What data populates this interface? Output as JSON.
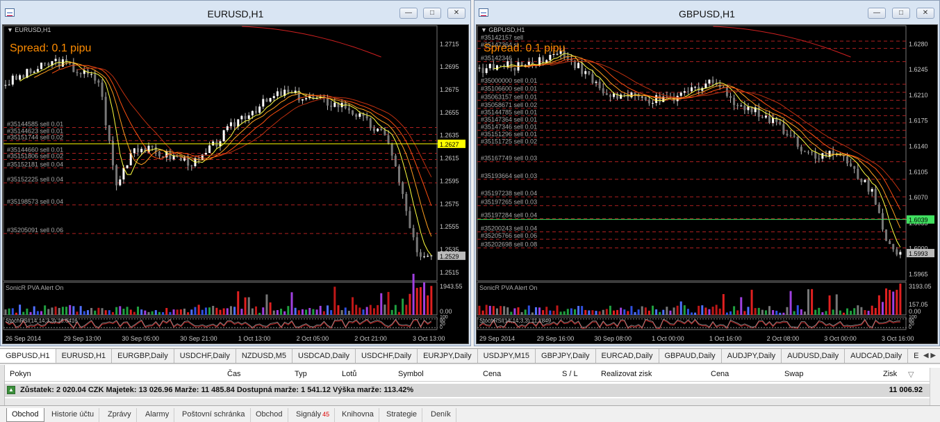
{
  "windows": [
    {
      "title": "EURUSD,H1",
      "symbol_label": "EURUSD,H1",
      "spread_text": "Spread: 0.1 pipu",
      "indicator_label": "SonicR PVA    Alert On",
      "osc_label": "StochRSI(14,14,3,3) 16.6416",
      "price_axis": [
        "1.2715",
        "1.2695",
        "1.2675",
        "1.2655",
        "1.2635",
        "1.2615",
        "1.2595",
        "1.2575",
        "1.2555",
        "1.2535",
        "1.2515"
      ],
      "price_range": [
        1.2507,
        1.2731
      ],
      "current_price": "1.2627",
      "bid_price": "1.2529",
      "volume_axis": [
        "1943.55",
        "0.00"
      ],
      "osc_axis": [
        "100",
        "80",
        "20",
        "0"
      ],
      "time_axis": [
        "26 Sep 2014",
        "29 Sep 13:00",
        "30 Sep 05:00",
        "30 Sep 21:00",
        "1 Oct 13:00",
        "2 Oct 05:00",
        "2 Oct 21:00",
        "3 Oct 13:00"
      ],
      "orders": [
        {
          "label": "#35144585 sell 0.01",
          "price": 1.26412
        },
        {
          "label": "#35144623 sell 0.01",
          "price": 1.26352
        },
        {
          "label": "#35151744 sell 0.02",
          "price": 1.26298
        },
        {
          "label": "#35144660 sell 0.01",
          "price": 1.26187
        },
        {
          "label": "#35151806 sell 0.02",
          "price": 1.26132
        },
        {
          "label": "#35152181 sell 0.04",
          "price": 1.2606
        },
        {
          "label": "#35152225 sell 0.04",
          "price": 1.25928
        },
        {
          "label": "#35198573 sell 0.04",
          "price": 1.25735
        },
        {
          "label": "#35205091 sell 0.06",
          "price": 1.25485
        }
      ],
      "colors": {
        "current_line": "#ffff00",
        "order_line": "#b02020",
        "bg": "#000000"
      }
    },
    {
      "title": "GBPUSD,H1",
      "symbol_label": "GBPUSD,H1",
      "spread_text": "Spread: 0.1 pipu",
      "indicator_label": "SonicR PVA    Alert On",
      "osc_label": "StochRSI(14,14,3,3) 11.1849",
      "price_axis": [
        "1.6280",
        "1.6245",
        "1.6210",
        "1.6175",
        "1.6140",
        "1.6105",
        "1.6070",
        "1.6035",
        "1.6000",
        "1.5965"
      ],
      "price_range": [
        1.5955,
        1.6305
      ],
      "current_price": "1.6039",
      "bid_price": "1.5993",
      "volume_axis": [
        "3193.05",
        "157.05",
        "0.00"
      ],
      "osc_axis": [
        "100",
        "80",
        "20",
        "0"
      ],
      "time_axis": [
        "29 Sep 2014",
        "29 Sep 16:00",
        "30 Sep 08:00",
        "1 Oct 00:00",
        "1 Oct 16:00",
        "2 Oct 08:00",
        "3 Oct 00:00",
        "3 Oct 16:00"
      ],
      "orders": [
        {
          "label": "#35142157 sell",
          "price": 1.6283
        },
        {
          "label": "#35147364 sl",
          "price": 1.6273
        },
        {
          "label": "#35142346",
          "price": 1.6255
        },
        {
          "label": "#35000000 sell 0.01",
          "price": 1.6224
        },
        {
          "label": "#35106600 sell 0.01",
          "price": 1.6213
        },
        {
          "label": "#35063157 sell 0.01",
          "price": 1.6202
        },
        {
          "label": "#35058671 sell 0.02",
          "price": 1.6191
        },
        {
          "label": "#35144785 sell 0.01",
          "price": 1.6181
        },
        {
          "label": "#35147364 sell 0.01",
          "price": 1.6171
        },
        {
          "label": "#35147346 sell 0.01",
          "price": 1.6161
        },
        {
          "label": "#35151296 sell 0.01",
          "price": 1.6151
        },
        {
          "label": "#35151725 sell 0.02",
          "price": 1.6141
        },
        {
          "label": "#35167749 sell 0.03",
          "price": 1.6118
        },
        {
          "label": "#35193664 sell 0.03",
          "price": 1.6094
        },
        {
          "label": "#35197238 sell 0.04",
          "price": 1.607
        },
        {
          "label": "#35197265 sell 0.03",
          "price": 1.6058
        },
        {
          "label": "#35197284 sell 0.04",
          "price": 1.604
        },
        {
          "label": "#35200243 sell 0.04",
          "price": 1.6022
        },
        {
          "label": "#35205766 sell 0.06",
          "price": 1.6012
        },
        {
          "label": "#35202698 sell 0.08",
          "price": 1.6
        }
      ],
      "colors": {
        "current_line": "#40e060",
        "order_line": "#b02020",
        "bg": "#000000"
      }
    }
  ],
  "chart_tabs": [
    "GBPUSD,H1",
    "EURUSD,H1",
    "EURGBP,Daily",
    "USDCHF,Daily",
    "NZDUSD,M5",
    "USDCAD,Daily",
    "USDCHF,Daily",
    "EURJPY,Daily",
    "USDJPY,M15",
    "GBPJPY,Daily",
    "EURCAD,Daily",
    "GBPAUD,Daily",
    "AUDJPY,Daily",
    "AUDUSD,Daily",
    "AUDCAD,Daily",
    "EU"
  ],
  "active_chart_tab": "GBPUSD,H1",
  "terminal": {
    "columns": [
      "Pokyn",
      "Čas",
      "Typ",
      "Lotů",
      "Symbol",
      "Cena",
      "S / L",
      "Realizovat zisk",
      "Cena",
      "Swap",
      "Zisk"
    ],
    "summary_text": "Zůstatek: 2 020.04 CZK  Majetek: 13 026.96  Marže: 11 485.84  Dostupná marže: 1 541.12  Výška marže: 113.42%",
    "summary_profit": "11 006.92",
    "tabs": [
      "Obchod",
      "Historie účtu",
      "Zprávy",
      "Alarmy",
      "Poštovní schránka",
      "Obchod",
      "Signály",
      "Knihovna",
      "Strategie",
      "Deník"
    ],
    "signals_badge": "45",
    "active_tab": "Obchod"
  }
}
